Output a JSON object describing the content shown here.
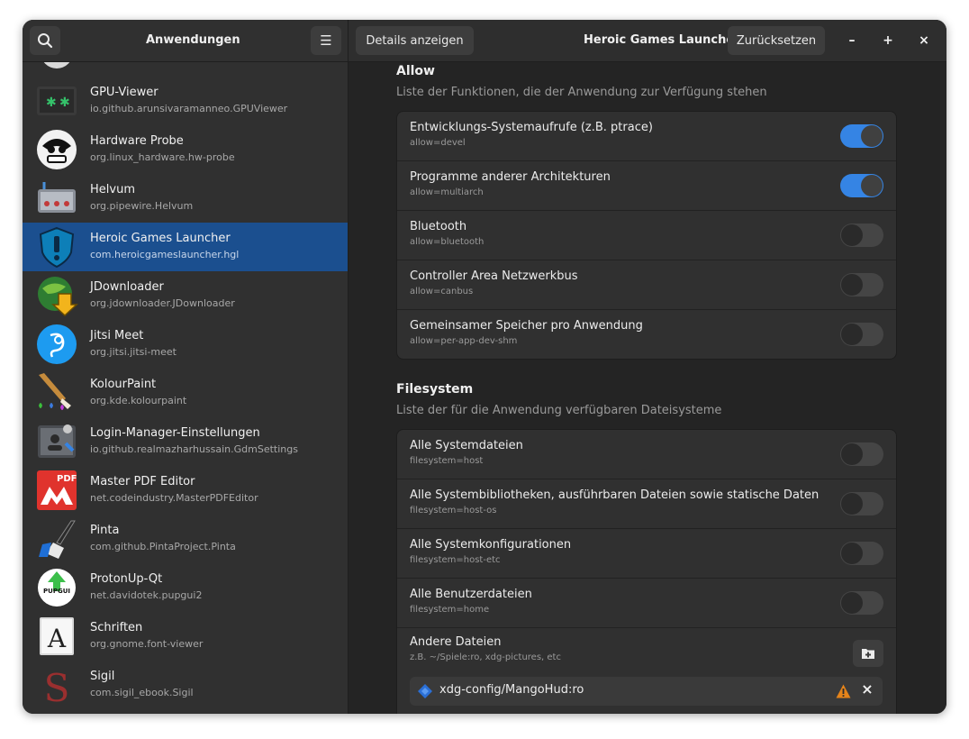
{
  "header": {
    "left_title": "Anwendungen",
    "details_button": "Details anzeigen",
    "app_title": "Heroic Games Launcher",
    "reset_button": "Zurücksetzen",
    "minimize": "–",
    "maximize": "+",
    "close": "×",
    "menu_icon": "☰"
  },
  "apps": [
    {
      "name": "GPU-Viewer",
      "id": "io.github.arunsivaramanneo.GPUViewer"
    },
    {
      "name": "Hardware Probe",
      "id": "org.linux_hardware.hw-probe"
    },
    {
      "name": "Helvum",
      "id": "org.pipewire.Helvum"
    },
    {
      "name": "Heroic Games Launcher",
      "id": "com.heroicgameslauncher.hgl"
    },
    {
      "name": "JDownloader",
      "id": "org.jdownloader.JDownloader"
    },
    {
      "name": "Jitsi Meet",
      "id": "org.jitsi.jitsi-meet"
    },
    {
      "name": "KolourPaint",
      "id": "org.kde.kolourpaint"
    },
    {
      "name": "Login-Manager-Einstellungen",
      "id": "io.github.realmazharhussain.GdmSettings"
    },
    {
      "name": "Master PDF Editor",
      "id": "net.codeindustry.MasterPDFEditor"
    },
    {
      "name": "Pinta",
      "id": "com.github.PintaProject.Pinta"
    },
    {
      "name": "ProtonUp-Qt",
      "id": "net.davidotek.pupgui2"
    },
    {
      "name": "Schriften",
      "id": "org.gnome.font-viewer"
    },
    {
      "name": "Sigil",
      "id": "com.sigil_ebook.Sigil"
    }
  ],
  "allow": {
    "title": "Allow",
    "subtitle": "Liste der Funktionen, die der Anwendung zur Verfügung stehen",
    "rows": [
      {
        "title": "Entwicklungs-Systemaufrufe (z.B. ptrace)",
        "sub": "allow=devel",
        "on": true
      },
      {
        "title": "Programme anderer Architekturen",
        "sub": "allow=multiarch",
        "on": true
      },
      {
        "title": "Bluetooth",
        "sub": "allow=bluetooth",
        "on": false
      },
      {
        "title": "Controller Area Netzwerkbus",
        "sub": "allow=canbus",
        "on": false
      },
      {
        "title": "Gemeinsamer Speicher pro Anwendung",
        "sub": "allow=per-app-dev-shm",
        "on": false
      }
    ]
  },
  "filesystem": {
    "title": "Filesystem",
    "subtitle": "Liste der für die Anwendung verfügbaren Dateisysteme",
    "rows": [
      {
        "title": "Alle Systemdateien",
        "sub": "filesystem=host",
        "on": false
      },
      {
        "title": "Alle Systembibliotheken, ausführbaren Dateien sowie statische Daten",
        "sub": "filesystem=host-os",
        "on": false
      },
      {
        "title": "Alle Systemkonfigurationen",
        "sub": "filesystem=host-etc",
        "on": false
      },
      {
        "title": "Alle Benutzerdateien",
        "sub": "filesystem=home",
        "on": false
      }
    ],
    "other": {
      "title": "Andere Dateien",
      "sub": "z.B. ~/Spiele:ro, xdg-pictures, etc",
      "entry": "xdg-config/MangoHud:ro",
      "entry_remove": "×"
    }
  },
  "colors": {
    "accent": "#3584e4",
    "selected_row": "#1b4f8f",
    "warning": "#e5841a"
  },
  "icons": [
    "search-icon",
    "menu-icon",
    "folder-add-icon",
    "warning-icon",
    "close-icon",
    "diamond-icon"
  ]
}
